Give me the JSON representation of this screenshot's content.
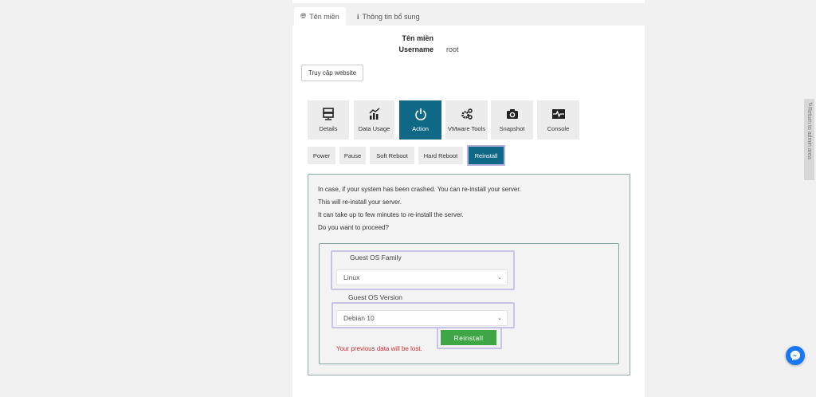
{
  "tabs": [
    {
      "label": "Tên miền",
      "icon": "globe-icon"
    },
    {
      "label": "Thông tin bổ sung",
      "icon": "info-icon"
    }
  ],
  "info": {
    "domain_label": "Tên miền",
    "domain_value": "",
    "username_label": "Username",
    "username_value": "root"
  },
  "visit_button": "Truy cập website",
  "tiles": [
    {
      "label": "Details",
      "icon": "server-icon"
    },
    {
      "label": "Data Usage",
      "icon": "chart-icon"
    },
    {
      "label": "Action",
      "icon": "power-icon"
    },
    {
      "label": "VMware Tools",
      "icon": "gears-icon"
    },
    {
      "label": "Snapshot",
      "icon": "camera-icon"
    },
    {
      "label": "Console",
      "icon": "pulse-icon"
    }
  ],
  "active_tile": "Action",
  "actions": [
    "Power",
    "Pause",
    "Soft Reboot",
    "Hard Reboot",
    "Reinstall"
  ],
  "active_action": "Reinstall",
  "message": [
    "In case, if your system has been crashed. You can re-install your server.",
    "This will re-install your server.",
    "It can take up to few minutes to re-install the server.",
    "Do you want to proceed?"
  ],
  "form": {
    "family_label": "Guest OS Family",
    "family_value": "Linux",
    "version_label": "Guest OS Version",
    "version_value": "Debian 10",
    "submit": "Reinstall",
    "warning": "Your previous data will be lost."
  },
  "side_tab": "Return to admin area",
  "colors": {
    "accent": "#0f6886",
    "success": "#3ea645",
    "danger": "#d0323a"
  }
}
